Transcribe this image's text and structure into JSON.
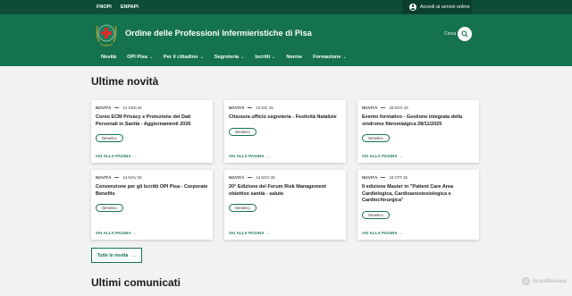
{
  "topbar": {
    "links": [
      "FNOPI",
      "ENPAPI"
    ],
    "login_label": "Accedi ai servizi online"
  },
  "header": {
    "site_title": "Ordine delle Professioni Infermieristiche di Pisa",
    "search_label": "Cerca"
  },
  "nav": {
    "items": [
      {
        "label": "Novità",
        "has_menu": false
      },
      {
        "label": "OPI Pisa",
        "has_menu": true
      },
      {
        "label": "Per il cittadino",
        "has_menu": true
      },
      {
        "label": "Segreteria",
        "has_menu": true
      },
      {
        "label": "Iscritti",
        "has_menu": true
      },
      {
        "label": "Norme",
        "has_menu": false
      },
      {
        "label": "Formazione",
        "has_menu": true
      }
    ]
  },
  "news": {
    "title": "Ultime novità",
    "cards": [
      {
        "category": "NOVITÀ",
        "date": "21 GEN 26",
        "title": "Corso ECM Privacy e Protezione dei Dati Personali in Sanità - Aggiornamenti 2026",
        "tag": "Generico",
        "link": "VAI ALLA PAGINA"
      },
      {
        "category": "NOVITÀ",
        "date": "10 DIC 25",
        "title": "Chiusura ufficio segreteria - Festività Natalizie",
        "tag": "Generico",
        "link": "VAI ALLA PAGINA"
      },
      {
        "category": "NOVITÀ",
        "date": "25 NOV 25",
        "title": "Evento formativo - Gestione integrata della sindrome fibromialgica 28/11/2025",
        "tag": "Generico",
        "link": "VAI ALLA PAGINA"
      },
      {
        "category": "NOVITÀ",
        "date": "24 NOV 25",
        "title": "Convenzione per gli Iscritti OPI Pisa - Corporate Benefits",
        "tag": "Generico",
        "link": "VAI ALLA PAGINA"
      },
      {
        "category": "NOVITÀ",
        "date": "13 NOV 25",
        "title": "20° Edizione del Forum Risk Management obiettivo sanità - salute",
        "tag": "Generico",
        "link": "VAI ALLA PAGINA"
      },
      {
        "category": "NOVITÀ",
        "date": "23 OTT 25",
        "title": "II edizione Master in \"Patient Care Area Cardiologica, Cardioanestesiologica e Cardiochirurgica\"",
        "tag": "Generico",
        "link": "VAI ALLA PAGINA"
      }
    ],
    "all_button": "Tutte le novità"
  },
  "communications": {
    "title": "Ultimi comunicati"
  },
  "watermark": "ScanMalware",
  "colors": {
    "topbar": "#0d4d36",
    "header": "#14724e",
    "accent": "#14724e",
    "background": "#f2f2f2"
  }
}
